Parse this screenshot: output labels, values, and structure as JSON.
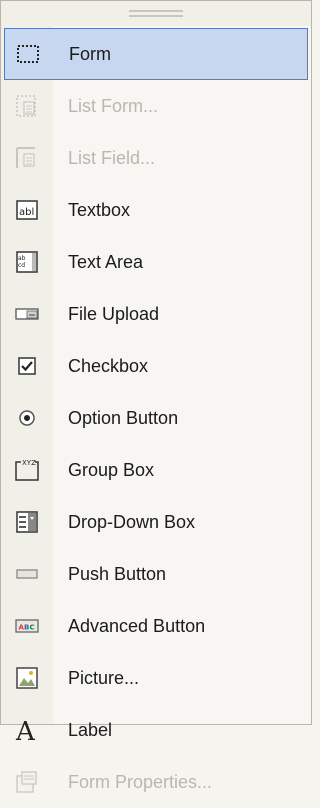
{
  "menu": {
    "items": [
      {
        "label": "Form",
        "icon": "form-marquee-icon",
        "state": "selected"
      },
      {
        "label": "List Form...",
        "icon": "list-form-icon",
        "state": "disabled"
      },
      {
        "label": "List Field...",
        "icon": "list-field-icon",
        "state": "disabled"
      },
      {
        "label": "Textbox",
        "icon": "textbox-icon",
        "state": "enabled"
      },
      {
        "label": "Text Area",
        "icon": "text-area-icon",
        "state": "enabled"
      },
      {
        "label": "File Upload",
        "icon": "file-upload-icon",
        "state": "enabled"
      },
      {
        "label": "Checkbox",
        "icon": "checkbox-icon",
        "state": "enabled"
      },
      {
        "label": "Option Button",
        "icon": "option-button-icon",
        "state": "enabled"
      },
      {
        "label": "Group Box",
        "icon": "group-box-icon",
        "state": "enabled"
      },
      {
        "label": "Drop-Down Box",
        "icon": "drop-down-box-icon",
        "state": "enabled"
      },
      {
        "label": "Push Button",
        "icon": "push-button-icon",
        "state": "enabled"
      },
      {
        "label": "Advanced Button",
        "icon": "advanced-button-icon",
        "state": "enabled"
      },
      {
        "label": "Picture...",
        "icon": "picture-icon",
        "state": "enabled"
      },
      {
        "label": "Label",
        "icon": "label-icon",
        "state": "enabled"
      },
      {
        "label": "Form Properties...",
        "icon": "form-properties-icon",
        "state": "disabled"
      }
    ]
  },
  "colors": {
    "selection_fill": "#c7d7f0",
    "selection_border": "#5d7ab8",
    "disabled_text": "#b9b7b0"
  }
}
